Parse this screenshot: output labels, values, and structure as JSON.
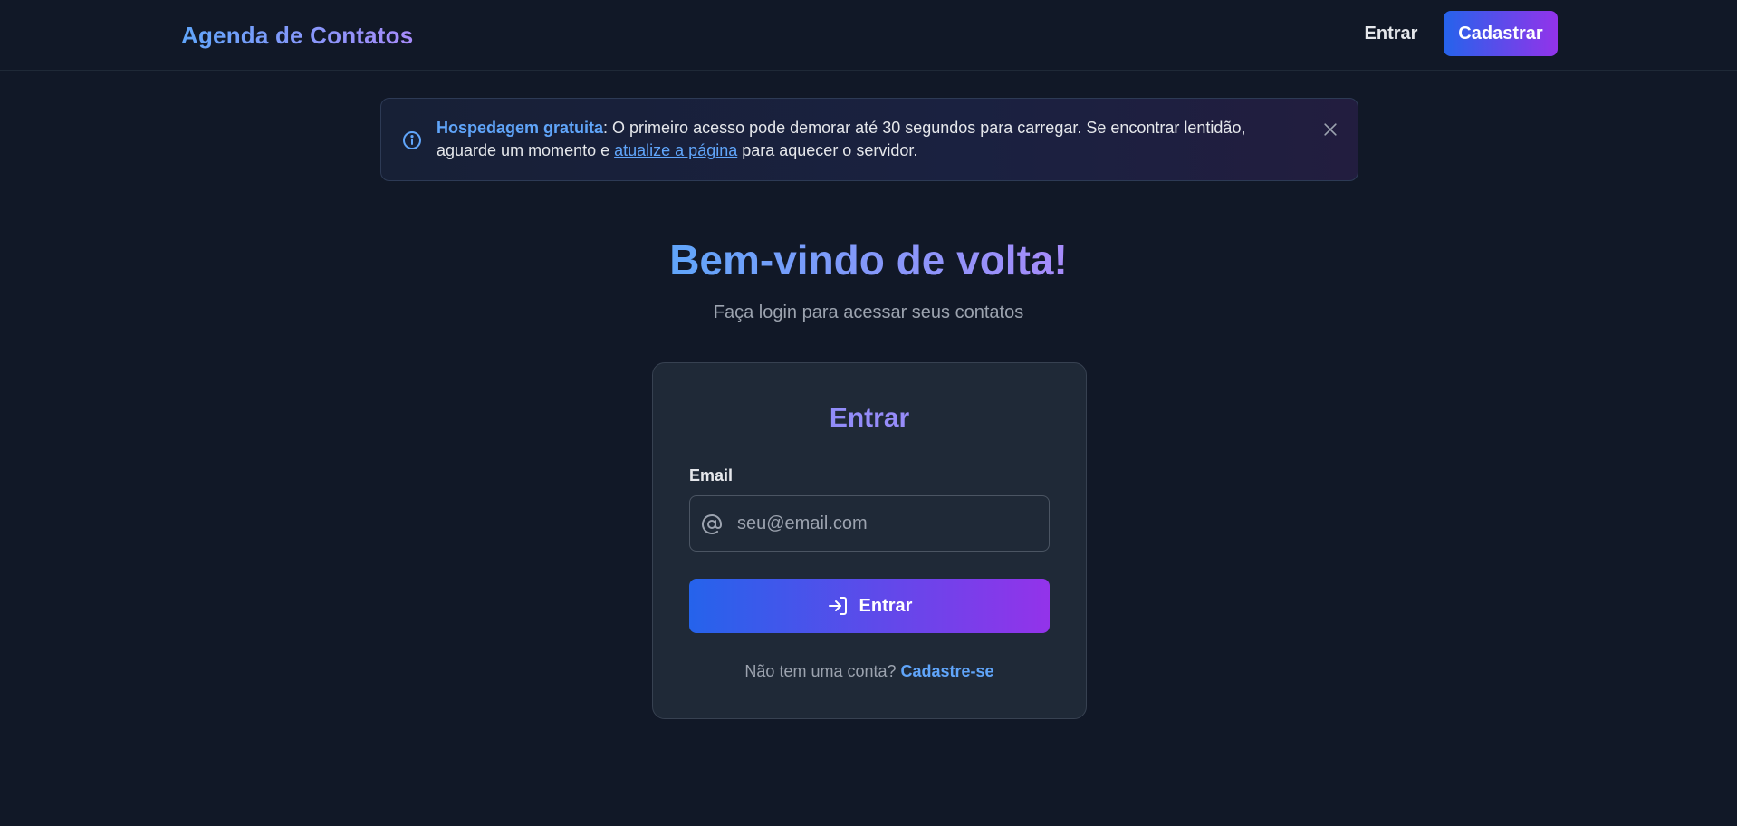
{
  "header": {
    "brand": "Agenda de Contatos",
    "login_label": "Entrar",
    "signup_label": "Cadastrar"
  },
  "banner": {
    "icon": "info-circle-icon",
    "strong": "Hospedagem gratuita",
    "text_before_link": ": O primeiro acesso pode demorar até 30 segundos para carregar. Se encontrar lentidão, aguarde um momento e ",
    "link": "atualize a página",
    "text_after_link": " para aquecer o servidor.",
    "close_icon": "close-icon"
  },
  "hero": {
    "title": "Bem-vindo de volta!",
    "subtitle": "Faça login para acessar seus contatos"
  },
  "card": {
    "title": "Entrar",
    "email_label": "Email",
    "email_placeholder": "seu@email.com",
    "email_value": "",
    "email_icon": "at-sign-icon",
    "submit_label": "Entrar",
    "submit_icon": "log-in-icon",
    "signup_prompt": "Não tem uma conta? ",
    "signup_link": "Cadastre-se"
  },
  "colors": {
    "background": "#111827",
    "card": "#1f2937",
    "accent_blue": "#2563eb",
    "accent_purple": "#9333ea",
    "link": "#60a5fa"
  }
}
